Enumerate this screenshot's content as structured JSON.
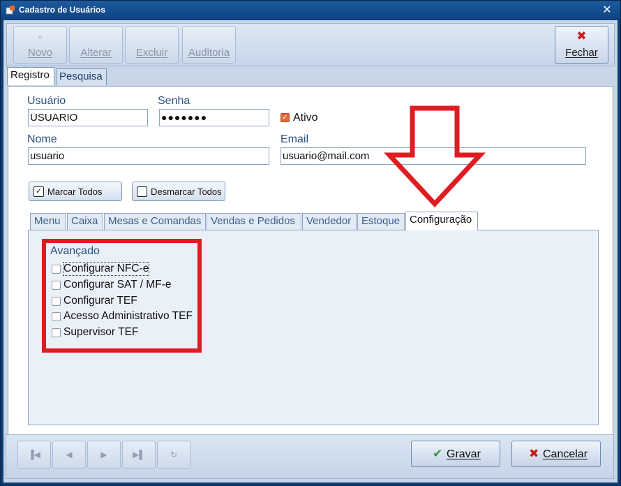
{
  "window": {
    "title": "Cadastro de Usuários"
  },
  "toolbar": {
    "novo": "Novo",
    "alterar": "Alterar",
    "excluir": "Excluir",
    "auditoria": "Auditoria",
    "fechar": "Fechar"
  },
  "tabs": [
    "Registro",
    "Pesquisa"
  ],
  "form": {
    "usuario_label": "Usuário",
    "usuario_value": "USUARIO",
    "senha_label": "Senha",
    "senha_value": "●●●●●●●",
    "ativo_label": "Ativo",
    "nome_label": "Nome",
    "nome_value": "usuario",
    "email_label": "Email",
    "email_value": "usuario@mail.com"
  },
  "actions": {
    "marcar_todos": "Marcar Todos",
    "desmarcar_todos": "Desmarcar Todos"
  },
  "permission_tabs": [
    "Menu",
    "Caixa",
    "Mesas e Comandas",
    "Vendas e Pedidos",
    "Vendedor",
    "Estoque",
    "Configuração"
  ],
  "config": {
    "group_title": "Avançado",
    "options": [
      "Configurar NFC-e",
      "Configurar SAT / MF-e",
      "Configurar TEF",
      "Acesso Administrativo TEF",
      "Supervisor TEF"
    ]
  },
  "bottom": {
    "gravar": "Gravar",
    "cancelar": "Cancelar"
  },
  "colors": {
    "annotation_red": "#e11b22",
    "accent_blue": "#0c3d75"
  }
}
